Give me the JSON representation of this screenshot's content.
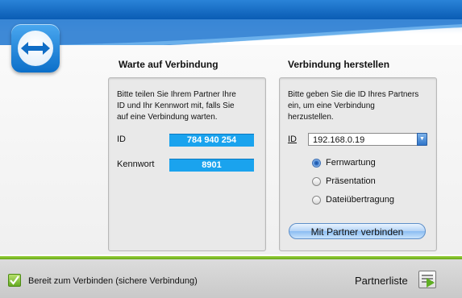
{
  "colors": {
    "brand_blue": "#0a5cb4",
    "value_blue": "#1aa3ee",
    "accent_green": "#66a81a"
  },
  "logo": {
    "icon": "teamviewer-arrows-icon"
  },
  "wait_panel": {
    "title": "Warte auf Verbindung",
    "description_lines": [
      "Bitte teilen Sie Ihrem Partner Ihre",
      "ID und Ihr Kennwort mit, falls Sie",
      "auf eine Verbindung warten."
    ],
    "id_label": "ID",
    "id_value": "784 940 254",
    "password_label": "Kennwort",
    "password_value": "8901"
  },
  "connect_panel": {
    "title": "Verbindung herstellen",
    "description_lines": [
      "Bitte geben Sie die ID Ihres Partners",
      "ein, um eine Verbindung",
      "herzustellen."
    ],
    "id_label": "ID",
    "id_input_value": "192.168.0.19",
    "options": [
      {
        "label": "Fernwartung",
        "checked": true
      },
      {
        "label": "Präsentation",
        "checked": false
      },
      {
        "label": "Dateiübertragung",
        "checked": false
      }
    ],
    "connect_button": "Mit Partner verbinden"
  },
  "status": {
    "icon": "check-icon",
    "text": "Bereit zum Verbinden (sichere Verbindung)",
    "partner_list": "Partnerliste",
    "partner_icon": "partner-list-icon"
  }
}
